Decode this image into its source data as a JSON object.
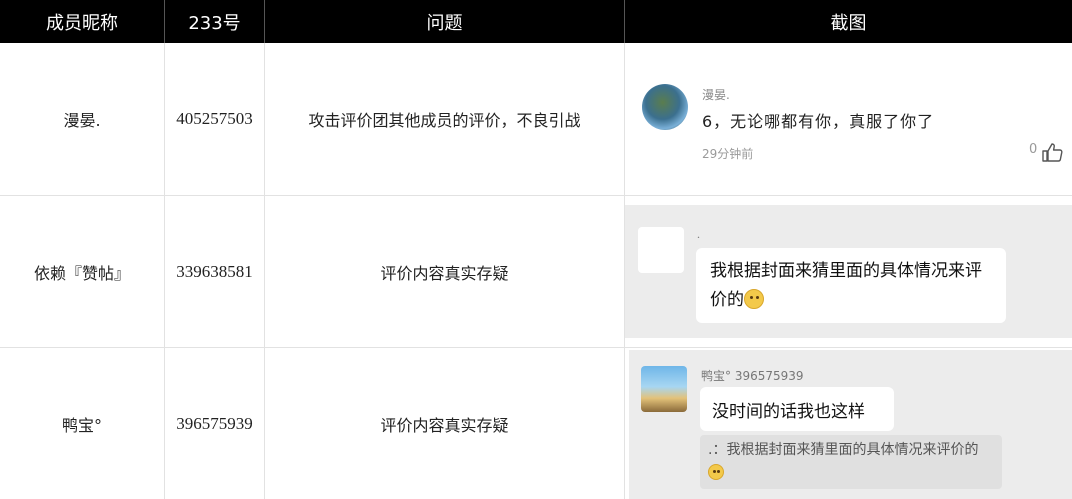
{
  "headers": [
    "成员昵称",
    "233号",
    "问题",
    "截图"
  ],
  "rows": [
    {
      "nickname": "漫晏.",
      "id": "405257503",
      "issue": "攻击评价团其他成员的评价，不良引战",
      "shot": {
        "name": "漫晏.",
        "message": "6，无论哪都有你，真服了你了",
        "time": "29分钟前",
        "likes": "0",
        "thumb_icon": "thumbs-up-icon"
      }
    },
    {
      "nickname": "依赖『赞帖』",
      "id": "339638581",
      "issue": "评价内容真实存疑",
      "shot": {
        "name": ".",
        "message": "我根据封面来猜里面的具体情况来评价的",
        "emoji": "crying-laughing-emoji-icon"
      }
    },
    {
      "nickname": "鸭宝°",
      "id": "396575939",
      "issue": "评价内容真实存疑",
      "shot": {
        "name": "鸭宝° 396575939",
        "message": "没时间的话我也这样",
        "quote": ".：我根据封面来猜里面的具体情况来评价的",
        "emoji": "crying-laughing-emoji-icon"
      }
    }
  ]
}
